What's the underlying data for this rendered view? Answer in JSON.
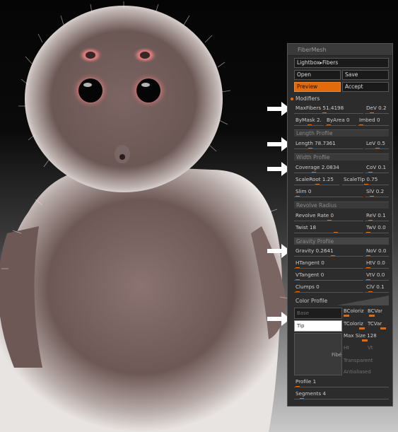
{
  "panel": {
    "title": "FiberMesh",
    "lightbox_label": "Lightbox▸Fibers",
    "open_label": "Open",
    "save_label": "Save",
    "preview_label": "Preview",
    "accept_label": "Accept",
    "modifiers_label": "Modifiers",
    "accent_color": "#e06a0c"
  },
  "sliders": {
    "maxfibers": {
      "label": "MaxFibers 51.4198",
      "level": 0.42
    },
    "dev": {
      "label": "DeV 0.2",
      "level": 0.2
    },
    "bymask": {
      "label": "ByMask 2.",
      "level": 0.5
    },
    "byarea": {
      "label": "ByArea 0",
      "level": 0.0
    },
    "imbed": {
      "label": "Imbed 0",
      "level": 0.0
    },
    "length": {
      "label": "Length 78.7361",
      "level": 0.2
    },
    "lev": {
      "label": "LeV 0.5",
      "level": 0.5
    },
    "coverage": {
      "label": "Coverage 2.0834",
      "level": 0.25
    },
    "cov": {
      "label": "CoV 0.1",
      "level": 0.1
    },
    "scaleroot": {
      "label": "ScaleRoot 1.25",
      "level": 0.5
    },
    "scaletip": {
      "label": "ScaleTip 0.75",
      "level": 0.5
    },
    "slim": {
      "label": "Slim 0",
      "level": 0.0
    },
    "slv": {
      "label": "SlV 0.2",
      "level": 0.2
    },
    "revolve_rate": {
      "label": "Revolve Rate 0",
      "level": 0.5
    },
    "rev": {
      "label": "ReV 0.1",
      "level": 0.1
    },
    "twist": {
      "label": "Twist 18",
      "level": 0.6
    },
    "twv": {
      "label": "TwV 0.0",
      "level": 0.0
    },
    "gravity": {
      "label": "Gravity 0.2641",
      "level": 0.55
    },
    "nov": {
      "label": "NoV 0.0",
      "level": 0.0
    },
    "htangent": {
      "label": "HTangent 0",
      "level": 0.0
    },
    "htv": {
      "label": "HtV 0.0",
      "level": 0.0
    },
    "vtangent": {
      "label": "VTangent 0",
      "level": 0.0
    },
    "vtv": {
      "label": "VtV 0.0",
      "level": 0.0
    },
    "clumps": {
      "label": "Clumps 0",
      "level": 0.0
    },
    "clv": {
      "label": "ClV 0.1",
      "level": 0.1
    },
    "profile": {
      "label": "Profile 1",
      "level": 0.0
    },
    "segments": {
      "label": "Segments 4",
      "level": 0.05
    }
  },
  "sections": {
    "length_profile": "Length Profile",
    "width_profile": "Width Profile",
    "revolve_radius": "Revolve Radius",
    "gravity_profile": "Gravity Profile",
    "color_profile": "Color Profile"
  },
  "color": {
    "base_label": "Base",
    "tip_label": "Tip",
    "fibers_label": "Fibé",
    "bcolorize": "BColoriz",
    "bcvar": "BCVar",
    "tcolorize": "TColoriz",
    "tcvar": "TCVar",
    "max_size": "Max Size 128",
    "ht": "Ht",
    "vt": "Vt",
    "transparent": "Transparent",
    "antialiased": "Antialiased"
  }
}
